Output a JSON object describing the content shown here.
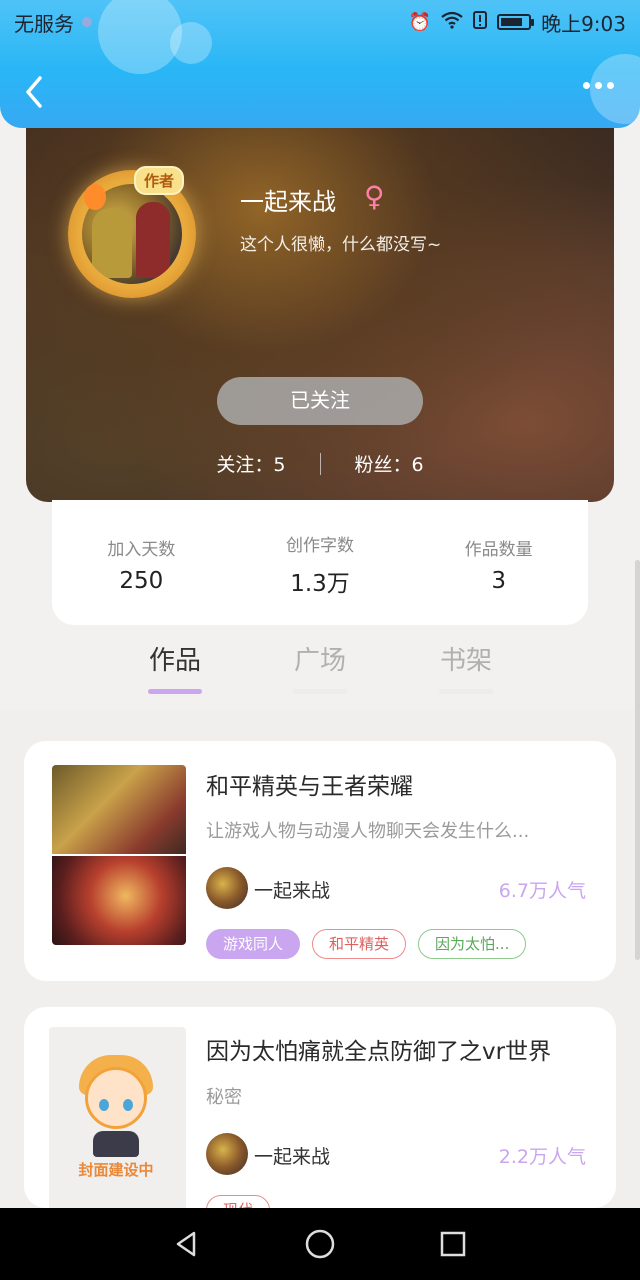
{
  "status_bar": {
    "carrier": "无服务",
    "time": "晚上9:03",
    "icons": [
      "alarm-icon",
      "wifi-icon",
      "alert-icon",
      "battery-icon"
    ]
  },
  "header": {
    "back_icon": "back-arrow-icon",
    "more_icon": "more-dots-icon"
  },
  "profile": {
    "author_badge": "作者",
    "name": "一起来战",
    "gender": "♀",
    "bio": "这个人很懒，什么都没写~",
    "follow_button": "已关注",
    "following": "关注：5",
    "followers": "粉丝：6"
  },
  "stats": [
    {
      "label": "加入天数",
      "value": "250"
    },
    {
      "label": "创作字数",
      "value": "1.3万"
    },
    {
      "label": "作品数量",
      "value": "3"
    }
  ],
  "tabs": [
    {
      "label": "作品",
      "active": true
    },
    {
      "label": "广场",
      "active": false
    },
    {
      "label": "书架",
      "active": false
    }
  ],
  "works": [
    {
      "title": "和平精英与王者荣耀",
      "desc": "让游戏人物与动漫人物聊天会发生什么...",
      "author": "一起来战",
      "popularity": "6.7万人气",
      "tags": [
        "游戏同人",
        "和平精英",
        "因为太怕..."
      ]
    },
    {
      "title": "因为太怕痛就全点防御了之vr世界",
      "desc": "秘密",
      "cover_text": "封面建设中",
      "author": "一起来战",
      "popularity": "2.2万人气",
      "tags": [
        "现代"
      ]
    }
  ],
  "colors": {
    "header_blue": "#29b6f6",
    "accent_purple": "#c9a6ef",
    "gender_pink": "#ff7fa8"
  }
}
